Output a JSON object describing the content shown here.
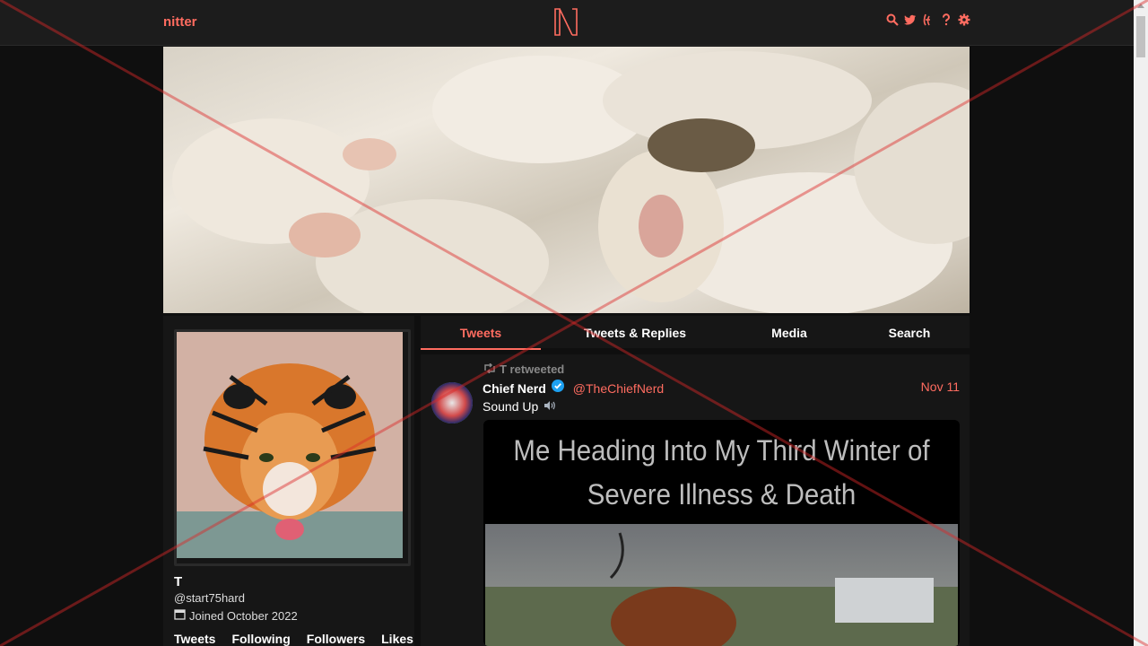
{
  "nav": {
    "brand": "nitter",
    "logo_icon": "nitter-logo",
    "icons": [
      "search-icon",
      "twitter-icon",
      "rss-icon",
      "help-icon",
      "settings-icon"
    ]
  },
  "profile": {
    "name": "T",
    "handle": "@start75hard",
    "joined": "Joined October 2022",
    "stats": [
      "Tweets",
      "Following",
      "Followers",
      "Likes"
    ]
  },
  "tabs": [
    {
      "label": "Tweets",
      "active": true
    },
    {
      "label": "Tweets & Replies",
      "active": false
    },
    {
      "label": "Media",
      "active": false
    },
    {
      "label": "Search",
      "active": false
    }
  ],
  "tweet": {
    "retweet_label": "T retweeted",
    "fullname": "Chief Nerd",
    "username": "@TheChiefNerd",
    "date": "Nov 11",
    "text": "Sound Up",
    "media_caption_line1": "Me Heading Into My Third Winter of",
    "media_caption_line2": "Severe Illness & Death"
  },
  "colors": {
    "accent": "#ff6c60",
    "background": "#0f0f0f",
    "panel": "#161616",
    "navbar": "#1c1c1c"
  }
}
